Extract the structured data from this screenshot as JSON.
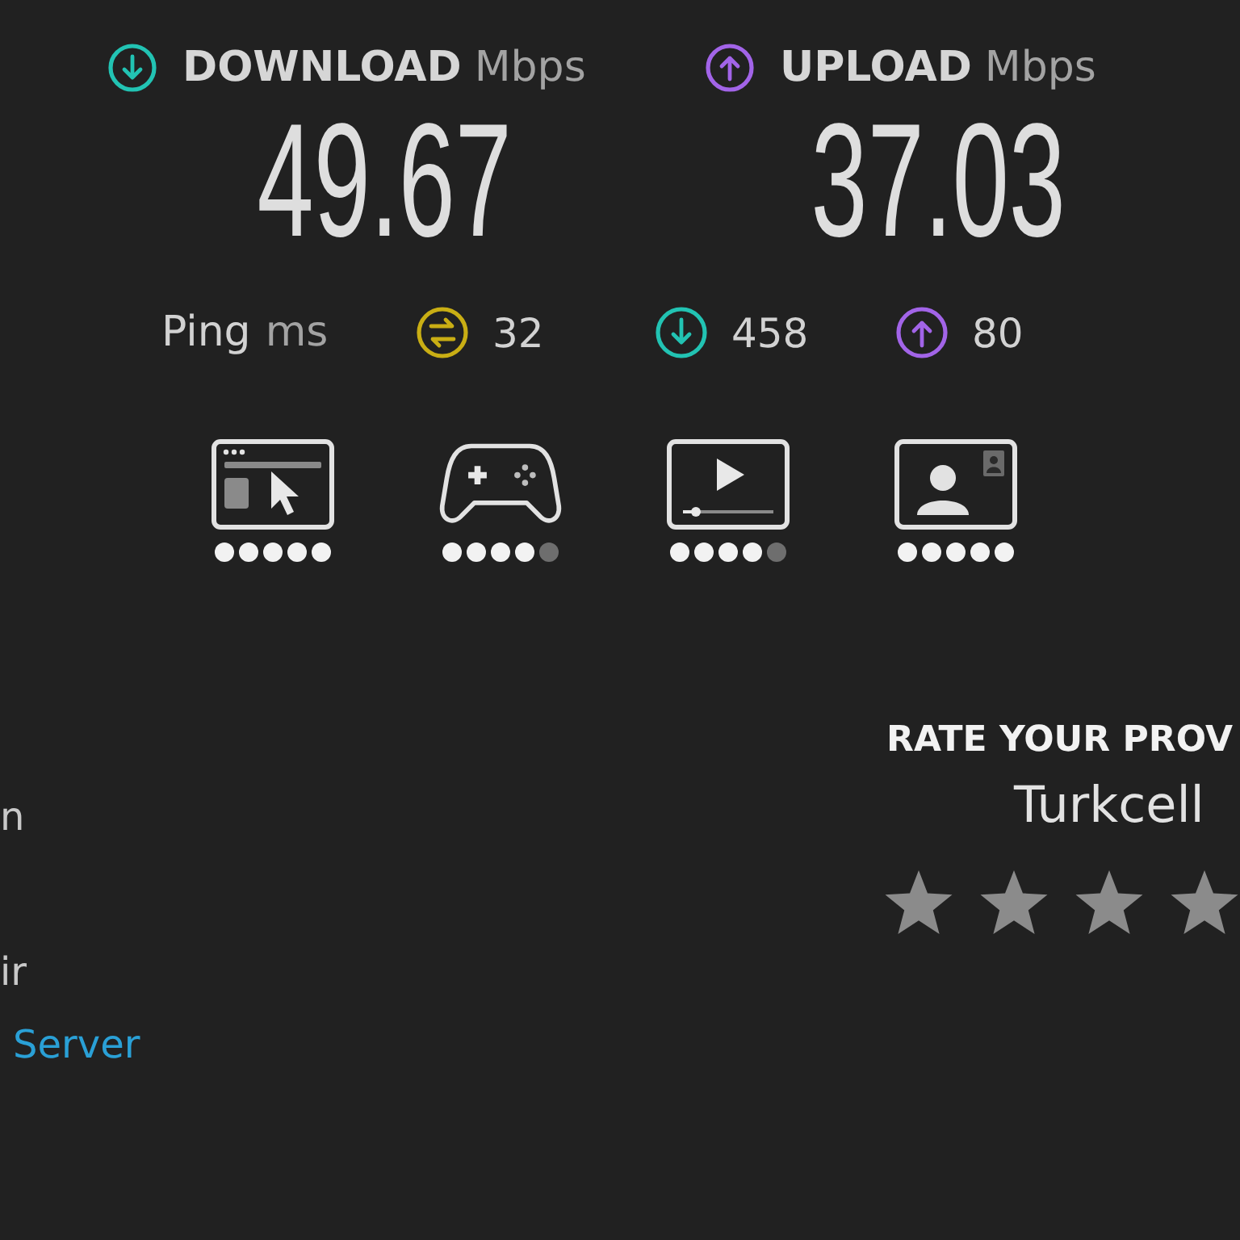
{
  "speeds": [
    {
      "kind": "download",
      "label": "DOWNLOAD",
      "unit": "Mbps",
      "value": "49.67"
    },
    {
      "kind": "upload",
      "label": "UPLOAD",
      "unit": "Mbps",
      "value": "37.03"
    }
  ],
  "ping": {
    "label": "Ping",
    "unit": "ms",
    "readings": [
      {
        "kind": "idle",
        "value": "32"
      },
      {
        "kind": "download",
        "value": "458"
      },
      {
        "kind": "upload",
        "value": "80"
      }
    ]
  },
  "quality": [
    {
      "kind": "browsing",
      "stars": 5
    },
    {
      "kind": "gaming",
      "stars": 4
    },
    {
      "kind": "streaming",
      "stars": 4
    },
    {
      "kind": "video_call",
      "stars": 5
    }
  ],
  "server_info": [
    {
      "kind": "text",
      "text": "n"
    },
    {
      "kind": "text",
      "text": "ir"
    },
    {
      "kind": "link",
      "text": "Server"
    }
  ],
  "rate_provider": {
    "title": "RATE YOUR PROV",
    "provider": "Turkcell"
  }
}
